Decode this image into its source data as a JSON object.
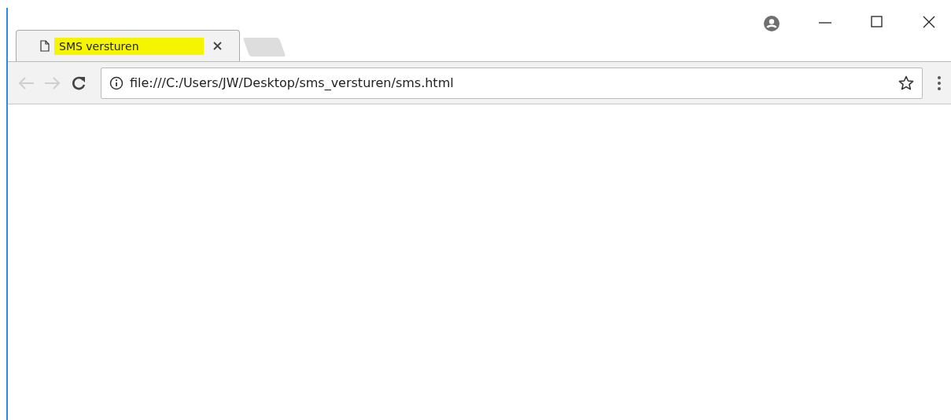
{
  "tabs": [
    {
      "title": "SMS versturen",
      "selected": true,
      "highlighted": true
    }
  ],
  "toolbar": {
    "back_disabled": true,
    "forward_disabled": true
  },
  "address_bar": {
    "value": "file:///C:/Users/JW/Desktop/sms_versturen/sms.html"
  }
}
